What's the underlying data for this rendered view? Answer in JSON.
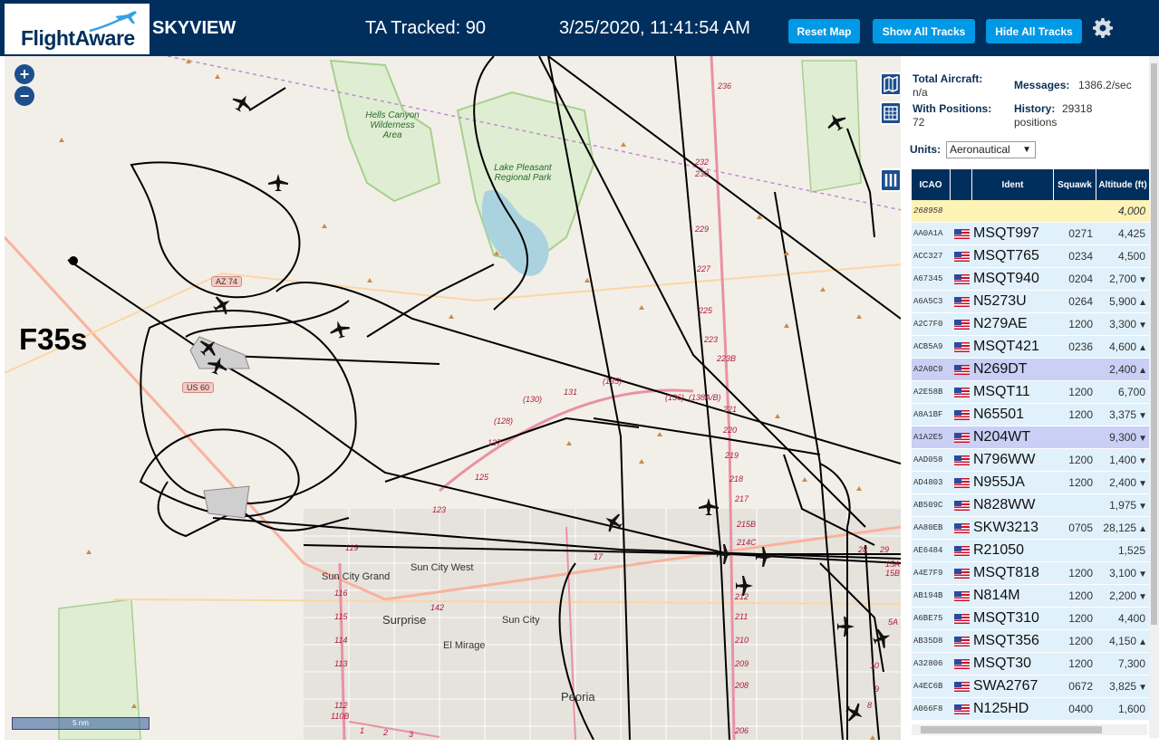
{
  "header": {
    "logo_text": "FlightAware",
    "app_title": "SKYVIEW",
    "ta_tracked": "TA Tracked: 90",
    "timestamp": "3/25/2020, 11:41:54 AM",
    "buttons": {
      "reset": "Reset Map",
      "show_all": "Show All Tracks",
      "hide_all": "Hide All Tracks"
    },
    "gear_icon": "gear-icon",
    "brand_color": "#002f5d",
    "button_color": "#0099e6"
  },
  "map": {
    "annotation": "F35s",
    "scale_label": "5 nm",
    "zoom_in": "+",
    "zoom_out": "−",
    "places": [
      "Sun City Grand",
      "Sun City West",
      "Surprise",
      "Sun City",
      "El Mirage",
      "Peoria"
    ],
    "parks": [
      "Hells Canyon Wilderness Area",
      "Lake Pleasant Regional Park"
    ],
    "road_shields": [
      "AZ 74",
      "US 60"
    ],
    "route_labels": [
      "236",
      "232",
      "230",
      "229",
      "227",
      "225",
      "223",
      "223B",
      "221",
      "220",
      "219",
      "218",
      "217",
      "215B",
      "214C",
      "212",
      "211",
      "210",
      "209",
      "208",
      "206",
      "131",
      "(135)",
      "(130)",
      "(136)",
      "(138A/B)",
      "(128)",
      "127",
      "125",
      "123",
      "119",
      "116",
      "115",
      "114",
      "113",
      "112",
      "110B",
      "142",
      "17",
      "1",
      "2",
      "3",
      "8",
      "9",
      "10",
      "15A",
      "15B",
      "28",
      "29",
      "5A"
    ]
  },
  "panel": {
    "total_aircraft_label": "Total Aircraft:",
    "total_aircraft": "n/a",
    "with_positions_label": "With Positions:",
    "with_positions": "72",
    "messages_label": "Messages:",
    "messages": "1386.2/sec",
    "history_label": "History:",
    "history": "29318",
    "history_unit": "positions",
    "units_label": "Units:",
    "units_value": "Aeronautical",
    "columns": [
      "ICAO",
      "",
      "Ident",
      "Squawk",
      "Altitude (ft)"
    ],
    "rows": [
      {
        "icao": "268958",
        "flag": false,
        "ident": "",
        "squawk": "",
        "alt": "4,000",
        "trend": "",
        "style": "hl"
      },
      {
        "icao": "AA0A1A",
        "flag": true,
        "ident": "MSQT997",
        "squawk": "0271",
        "alt": "4,425",
        "trend": "",
        "style": ""
      },
      {
        "icao": "ACC327",
        "flag": true,
        "ident": "MSQT765",
        "squawk": "0234",
        "alt": "4,500",
        "trend": "",
        "style": ""
      },
      {
        "icao": "A67345",
        "flag": true,
        "ident": "MSQT940",
        "squawk": "0204",
        "alt": "2,700",
        "trend": "▼",
        "style": ""
      },
      {
        "icao": "A6A5C3",
        "flag": true,
        "ident": "N5273U",
        "squawk": "0264",
        "alt": "5,900",
        "trend": "▲",
        "style": ""
      },
      {
        "icao": "A2C7F0",
        "flag": true,
        "ident": "N279AE",
        "squawk": "1200",
        "alt": "3,300",
        "trend": "▼",
        "style": ""
      },
      {
        "icao": "ACB5A9",
        "flag": true,
        "ident": "MSQT421",
        "squawk": "0236",
        "alt": "4,600",
        "trend": "▲",
        "style": ""
      },
      {
        "icao": "A2A0C9",
        "flag": true,
        "ident": "N269DT",
        "squawk": "",
        "alt": "2,400",
        "trend": "▲",
        "style": "sel"
      },
      {
        "icao": "A2E58B",
        "flag": true,
        "ident": "MSQT11",
        "squawk": "1200",
        "alt": "6,700",
        "trend": "",
        "style": ""
      },
      {
        "icao": "A8A1BF",
        "flag": true,
        "ident": "N65501",
        "squawk": "1200",
        "alt": "3,375",
        "trend": "▼",
        "style": ""
      },
      {
        "icao": "A1A2E5",
        "flag": true,
        "ident": "N204WT",
        "squawk": "",
        "alt": "9,300",
        "trend": "▼",
        "style": "sel"
      },
      {
        "icao": "AAD058",
        "flag": true,
        "ident": "N796WW",
        "squawk": "1200",
        "alt": "1,400",
        "trend": "▼",
        "style": ""
      },
      {
        "icao": "AD4803",
        "flag": true,
        "ident": "N955JA",
        "squawk": "1200",
        "alt": "2,400",
        "trend": "▼",
        "style": ""
      },
      {
        "icao": "AB509C",
        "flag": true,
        "ident": "N828WW",
        "squawk": "",
        "alt": "1,975",
        "trend": "▼",
        "style": ""
      },
      {
        "icao": "AA80EB",
        "flag": true,
        "ident": "SKW3213",
        "squawk": "0705",
        "alt": "28,125",
        "trend": "▲",
        "style": ""
      },
      {
        "icao": "AE6484",
        "flag": true,
        "ident": "R21050",
        "squawk": "",
        "alt": "1,525",
        "trend": "",
        "style": ""
      },
      {
        "icao": "A4E7F9",
        "flag": true,
        "ident": "MSQT818",
        "squawk": "1200",
        "alt": "3,100",
        "trend": "▼",
        "style": ""
      },
      {
        "icao": "AB194B",
        "flag": true,
        "ident": "N814M",
        "squawk": "1200",
        "alt": "2,200",
        "trend": "▼",
        "style": ""
      },
      {
        "icao": "A6BE75",
        "flag": true,
        "ident": "MSQT310",
        "squawk": "1200",
        "alt": "4,400",
        "trend": "",
        "style": ""
      },
      {
        "icao": "AB35D8",
        "flag": true,
        "ident": "MSQT356",
        "squawk": "1200",
        "alt": "4,150",
        "trend": "▲",
        "style": ""
      },
      {
        "icao": "A32806",
        "flag": true,
        "ident": "MSQT30",
        "squawk": "1200",
        "alt": "7,300",
        "trend": "",
        "style": ""
      },
      {
        "icao": "A4EC6B",
        "flag": true,
        "ident": "SWA2767",
        "squawk": "0672",
        "alt": "3,825",
        "trend": "▼",
        "style": ""
      },
      {
        "icao": "A066F8",
        "flag": true,
        "ident": "N125HD",
        "squawk": "0400",
        "alt": "1,600",
        "trend": "",
        "style": ""
      }
    ]
  }
}
